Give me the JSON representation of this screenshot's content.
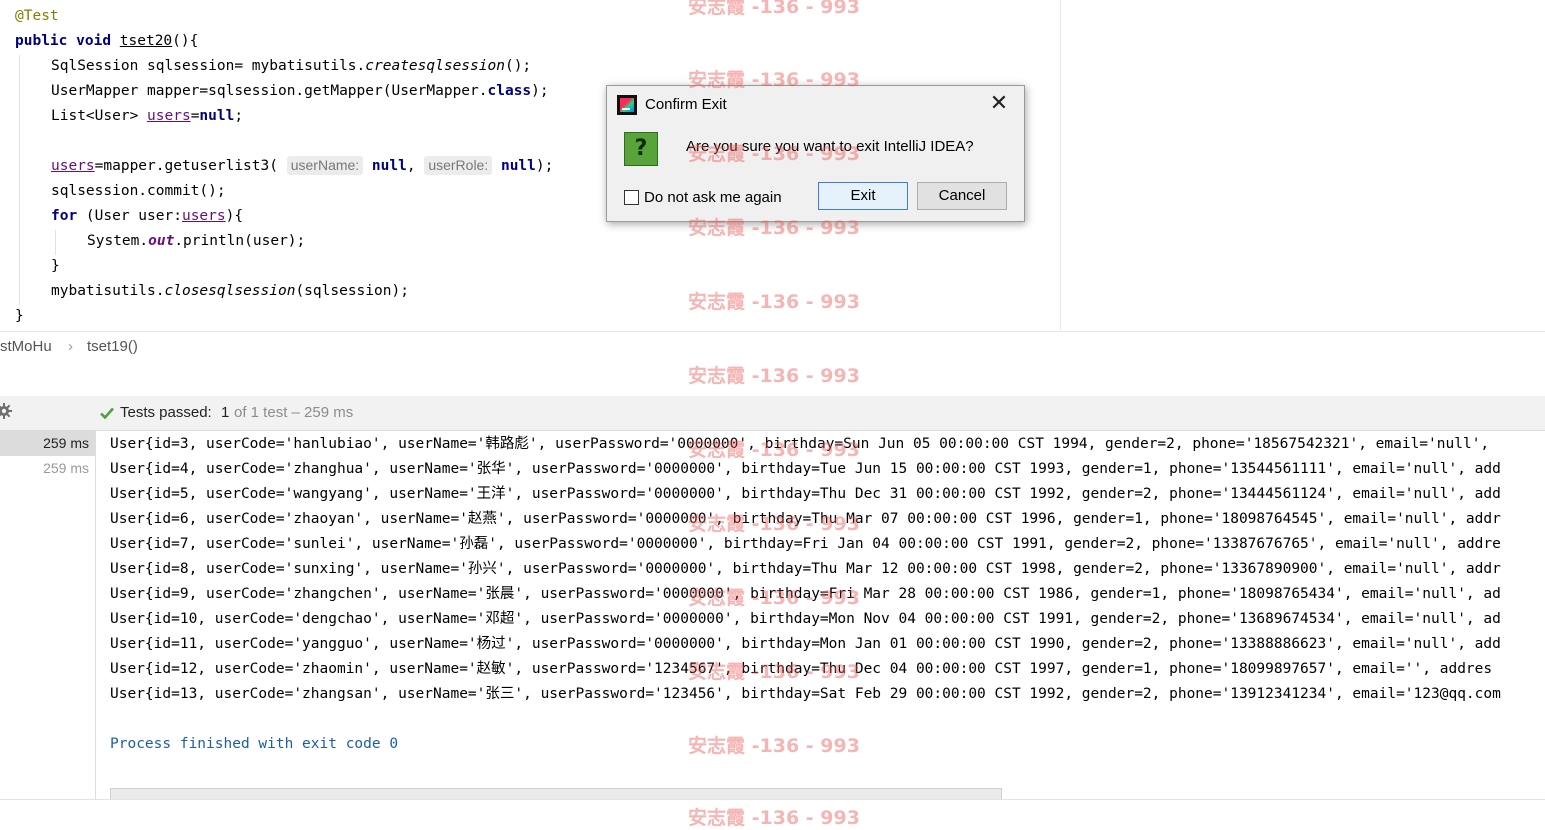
{
  "editor": {
    "lines": {
      "l1": {
        "annotation": "@Test"
      },
      "l2": {
        "kw_public": "public",
        "kw_void": "void",
        "method": "tset20",
        "rest": "(){"
      },
      "l3": {
        "a": "SqlSession sqlsession= mybatisutils.",
        "method": "createsqlsession",
        "b": "();"
      },
      "l4": {
        "a": "UserMapper mapper=sqlsession.getMapper(UserMapper.",
        "kw_class": "class",
        "b": ");"
      },
      "l5": {
        "a": "List<User> ",
        "var": "users",
        "b": "=",
        "kw_null": "null",
        "c": ";"
      },
      "l7": {
        "var": "users",
        "a": "=mapper.getuserlist3( ",
        "hint1": "userName:",
        "null1": "null",
        "comma": ", ",
        "hint2": "userRole:",
        "null2": "null",
        "b": ");"
      },
      "l8": {
        "text": "sqlsession.commit();"
      },
      "l9": {
        "kw_for": "for",
        "a": " (User user:",
        "var": "users",
        "b": "){"
      },
      "l10": {
        "a": "System.",
        "field": "out",
        "b": ".println(user);"
      },
      "l11": {
        "text": "}"
      },
      "l12": {
        "a": "mybatisutils.",
        "method": "closesqlsession",
        "b": "(sqlsession);"
      },
      "l13": {
        "text": "}"
      }
    }
  },
  "breadcrumb": {
    "class_name": "stMoHu",
    "separator": "›",
    "method": "tset19()"
  },
  "test_bar": {
    "status_label": "Tests passed:",
    "passed": "1",
    "of_total": "of 1 test – 259 ms",
    "check_icon": "check-icon",
    "settings_icon": "gear-icon"
  },
  "timings": [
    "259 ms",
    "259 ms"
  ],
  "console": {
    "lines": [
      "User{id=3, userCode='hanlubiao', userName='韩路彪', userPassword='0000000', birthday=Sun Jun 05 00:00:00 CST 1994, gender=2, phone='18567542321', email='null', ",
      "User{id=4, userCode='zhanghua', userName='张华', userPassword='0000000', birthday=Tue Jun 15 00:00:00 CST 1993, gender=1, phone='13544561111', email='null', add",
      "User{id=5, userCode='wangyang', userName='王洋', userPassword='0000000', birthday=Thu Dec 31 00:00:00 CST 1992, gender=2, phone='13444561124', email='null', add",
      "User{id=6, userCode='zhaoyan', userName='赵燕', userPassword='0000000', birthday=Thu Mar 07 00:00:00 CST 1996, gender=1, phone='18098764545', email='null', addr",
      "User{id=7, userCode='sunlei', userName='孙磊', userPassword='0000000', birthday=Fri Jan 04 00:00:00 CST 1991, gender=2, phone='13387676765', email='null', addre",
      "User{id=8, userCode='sunxing', userName='孙兴', userPassword='0000000', birthday=Thu Mar 12 00:00:00 CST 1998, gender=2, phone='13367890900', email='null', addr",
      "User{id=9, userCode='zhangchen', userName='张晨', userPassword='0000000', birthday=Fri Mar 28 00:00:00 CST 1986, gender=1, phone='18098765434', email='null', ad",
      "User{id=10, userCode='dengchao', userName='邓超', userPassword='0000000', birthday=Mon Nov 04 00:00:00 CST 1991, gender=2, phone='13689674534', email='null', ad",
      "User{id=11, userCode='yangguo', userName='杨过', userPassword='0000000', birthday=Mon Jan 01 00:00:00 CST 1990, gender=2, phone='13388886623', email='null', add",
      "User{id=12, userCode='zhaomin', userName='赵敏', userPassword='1234567', birthday=Thu Dec 04 00:00:00 CST 1997, gender=1, phone='18099897657', email='', addres",
      "User{id=13, userCode='zhangsan', userName='张三', userPassword='123456', birthday=Sat Feb 29 00:00:00 CST 1992, gender=2, phone='13912341234', email='123@qq.com"
    ],
    "finished": "Process finished with exit code 0"
  },
  "watermark": "安志霞 -136 - 993",
  "dialog": {
    "title": "Confirm Exit",
    "close_glyph": "✕",
    "message": "Are you sure you want to exit IntelliJ IDEA?",
    "question_glyph": "?",
    "checkbox_label": "Do not ask me again",
    "exit_label": "Exit",
    "cancel_label": "Cancel"
  }
}
